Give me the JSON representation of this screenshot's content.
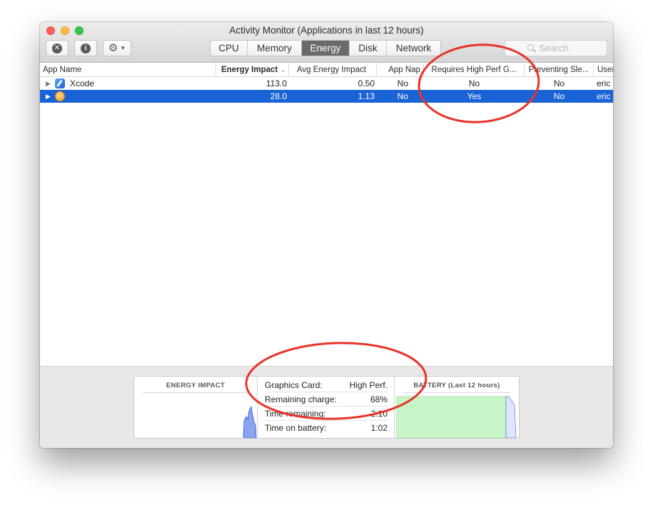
{
  "window": {
    "title": "Activity Monitor (Applications in last 12 hours)"
  },
  "toolbar": {
    "stop_icon": "x-circle-icon",
    "info_icon": "info-circle-icon",
    "gear_icon": "gear-icon",
    "tabs": [
      {
        "label": "CPU",
        "active": false
      },
      {
        "label": "Memory",
        "active": false
      },
      {
        "label": "Energy",
        "active": true
      },
      {
        "label": "Disk",
        "active": false
      },
      {
        "label": "Network",
        "active": false
      }
    ],
    "search_placeholder": "Search"
  },
  "table": {
    "columns": [
      {
        "label": "App Name"
      },
      {
        "label": "Energy Impact",
        "sorted": true
      },
      {
        "label": "Avg Energy Impact"
      },
      {
        "label": "App Nap"
      },
      {
        "label": "Requires High Perf G..."
      },
      {
        "label": "Preventing Sle..."
      },
      {
        "label": "User"
      }
    ],
    "rows": [
      {
        "name": "Xcode",
        "icon": "xcode-icon",
        "energy": "113.0",
        "avg": "0.50",
        "nap": "No",
        "highperf": "No",
        "sleep": "No",
        "user": "eric",
        "selected": false
      },
      {
        "name": "",
        "icon": "app-icon",
        "energy": "28.0",
        "avg": "1.13",
        "nap": "No",
        "highperf": "Yes",
        "sleep": "No",
        "user": "eric",
        "selected": true
      }
    ]
  },
  "bottom": {
    "energy_title": "ENERGY IMPACT",
    "stats": [
      {
        "label": "Graphics Card:",
        "value": "High Perf."
      },
      {
        "label": "Remaining charge:",
        "value": "68%"
      },
      {
        "label": "Time remaining:",
        "value": "2:10"
      },
      {
        "label": "Time on battery:",
        "value": "1:02"
      }
    ],
    "battery_title": "BATTERY (Last 12 hours)"
  },
  "colors": {
    "selection": "#1a63d6",
    "active_tab": "#6a6a6a",
    "annotation": "#e8332a",
    "battery_fill": "#c8f5c8",
    "energy_fill": "#8aa4f0"
  }
}
